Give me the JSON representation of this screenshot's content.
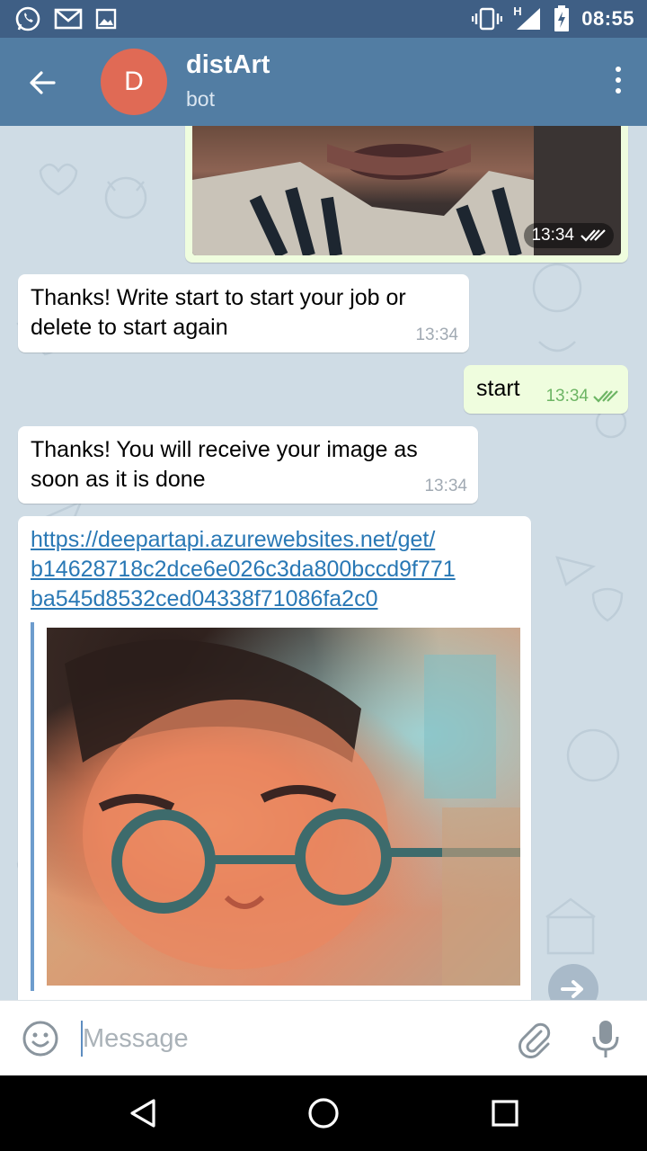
{
  "status_bar": {
    "time": "08:55",
    "network": "H",
    "icons": [
      "whatsapp-icon",
      "gmail-icon",
      "gallery-icon",
      "vibrate-icon",
      "signal-icon",
      "battery-charging-icon"
    ]
  },
  "header": {
    "avatar_letter": "D",
    "title": "distArt",
    "subtitle": "bot",
    "avatar_color": "#e06a55",
    "bar_color": "#527da3"
  },
  "messages": [
    {
      "type": "photo",
      "direction": "out",
      "time": "13:34",
      "status": "read"
    },
    {
      "type": "text",
      "direction": "in",
      "text": [
        "Thanks! Write start to start your job or",
        "delete to start again"
      ],
      "time": "13:34"
    },
    {
      "type": "text",
      "direction": "out",
      "text": "start",
      "time": "13:34",
      "status": "read"
    },
    {
      "type": "text",
      "direction": "in",
      "text": [
        "Thanks! You will receive your image as",
        "soon as it is done"
      ],
      "time": "13:34"
    },
    {
      "type": "link",
      "direction": "in",
      "link": [
        "https://deepartapi.azurewebsites.net/get/",
        "b14628718c2dce6e026c3da800bccd9f771",
        "ba545d8532ced04338f71086fa2c0"
      ]
    }
  ],
  "input": {
    "placeholder": "Message"
  }
}
